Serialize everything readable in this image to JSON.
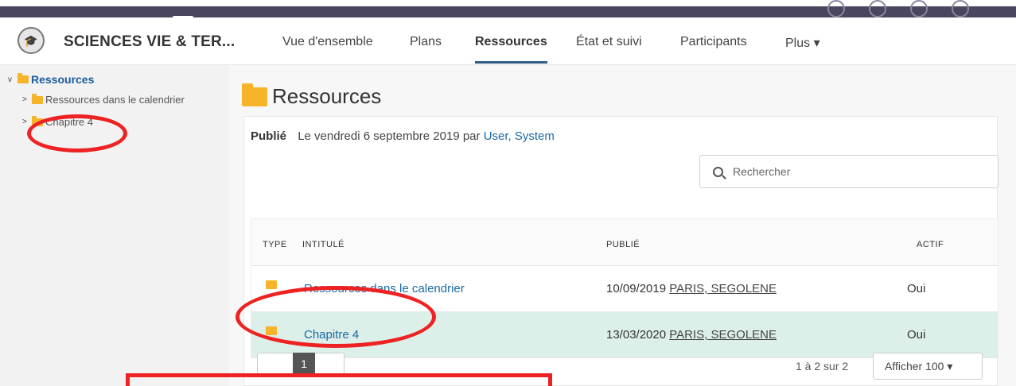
{
  "course": {
    "title": "SCIENCES VIE & TER...",
    "icon": "graduation-cap-icon"
  },
  "nav": {
    "items": [
      {
        "label": "Vue d'ensemble"
      },
      {
        "label": "Plans"
      },
      {
        "label": "Ressources",
        "active": true
      },
      {
        "label": "État et suivi"
      },
      {
        "label": "Participants"
      },
      {
        "label": "Plus ▾"
      }
    ]
  },
  "sidebar": {
    "root_label": "Ressources",
    "children": [
      {
        "label": "Ressources dans le calendrier"
      },
      {
        "label": "Chapitre 4"
      }
    ]
  },
  "main": {
    "heading": "Ressources",
    "published_label": "Publié",
    "published_text": "Le vendredi 6 septembre 2019 par",
    "published_by": "User, System",
    "search_placeholder": "Rechercher",
    "table": {
      "headers": [
        "TYPE",
        "INTITULÉ",
        "PUBLIÉ",
        "ACTIF"
      ],
      "rows": [
        {
          "title": "Ressources dans le calendrier",
          "date": "10/09/2019",
          "author": "PARIS, SEGOLENE",
          "active": "Oui"
        },
        {
          "title": "Chapitre 4",
          "date": "13/03/2020",
          "author": "PARIS, SEGOLENE",
          "active": "Oui"
        }
      ]
    },
    "pagination": {
      "current_page": "1",
      "count_text": "1 à 2 sur 2",
      "per_page": "Afficher 100 ▾"
    }
  },
  "colors": {
    "topbar": "#4a4560",
    "link": "#1a6aa6",
    "folder": "#f6b42a",
    "highlight_row": "#dcefe8",
    "annotation": "#ee2222"
  }
}
